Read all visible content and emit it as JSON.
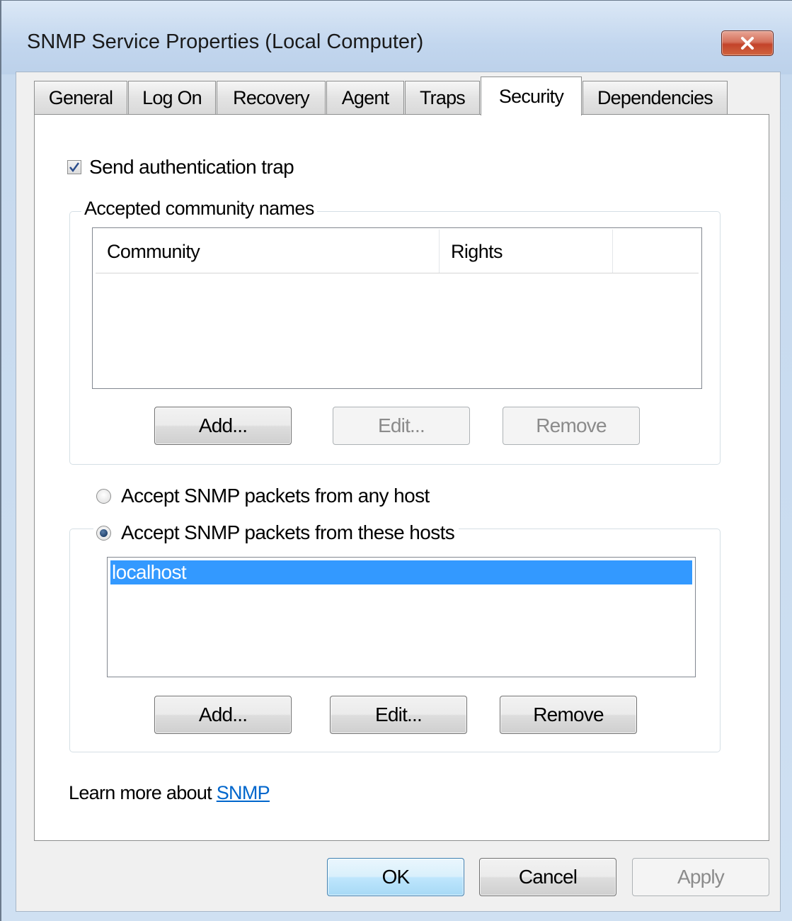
{
  "window": {
    "title": "SNMP Service Properties (Local Computer)"
  },
  "tabs": [
    {
      "label": "General"
    },
    {
      "label": "Log On"
    },
    {
      "label": "Recovery"
    },
    {
      "label": "Agent"
    },
    {
      "label": "Traps"
    },
    {
      "label": "Security",
      "active": true
    },
    {
      "label": "Dependencies"
    }
  ],
  "security": {
    "send_auth_trap": {
      "label": "Send authentication trap",
      "checked": true
    },
    "community_group": {
      "legend": "Accepted community names",
      "columns": [
        "Community",
        "Rights"
      ],
      "rows": [],
      "buttons": {
        "add": "Add...",
        "edit": "Edit...",
        "remove": "Remove"
      }
    },
    "accept_any": {
      "label": "Accept SNMP packets from any host",
      "selected": false
    },
    "accept_these": {
      "label": "Accept SNMP packets from these hosts",
      "selected": true
    },
    "hosts": {
      "items": [
        "localhost"
      ],
      "selected": "localhost",
      "buttons": {
        "add": "Add...",
        "edit": "Edit...",
        "remove": "Remove"
      }
    },
    "learn_more": {
      "prefix": "Learn more about ",
      "link": "SNMP"
    }
  },
  "footer": {
    "ok": "OK",
    "cancel": "Cancel",
    "apply": "Apply"
  },
  "colors": {
    "selection": "#3399ff",
    "link": "#0066cc",
    "close_button": "#c3432a"
  }
}
